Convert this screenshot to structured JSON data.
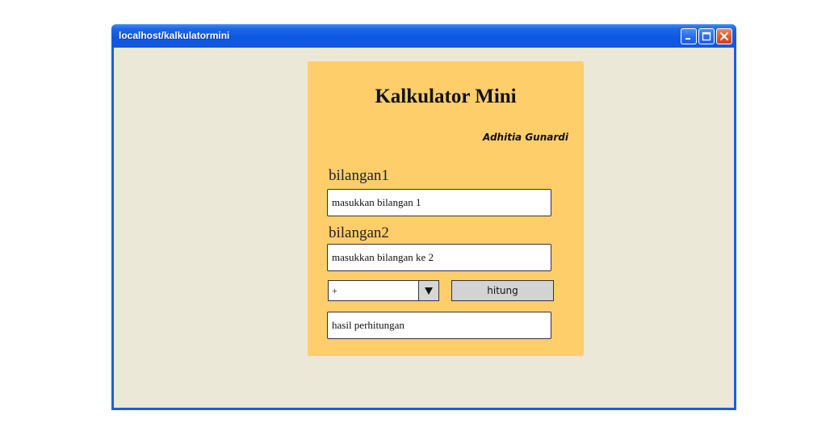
{
  "window": {
    "title": "localhost/kalkulatormini",
    "controls": {
      "minimize": "minimize-icon",
      "maximize": "maximize-icon",
      "close": "close-icon"
    },
    "accent_color": "#1a5fe0",
    "background_color": "#ece8d8"
  },
  "app": {
    "heading": "Kalkulator Mini",
    "author": "Adhitia Gunardi",
    "card_color": "#fece6b",
    "fields": {
      "bilangan1": {
        "label": "bilangan1",
        "value": "",
        "placeholder": "masukkan bilangan 1"
      },
      "bilangan2": {
        "label": "bilangan2",
        "value": "",
        "placeholder": "masukkan bilangan ke 2"
      }
    },
    "operator": {
      "selected": "+",
      "arrow_icon": "triangle-down-icon"
    },
    "calculate_label": "hitung",
    "result": {
      "value": "",
      "placeholder": "hasil perhitungan"
    }
  }
}
